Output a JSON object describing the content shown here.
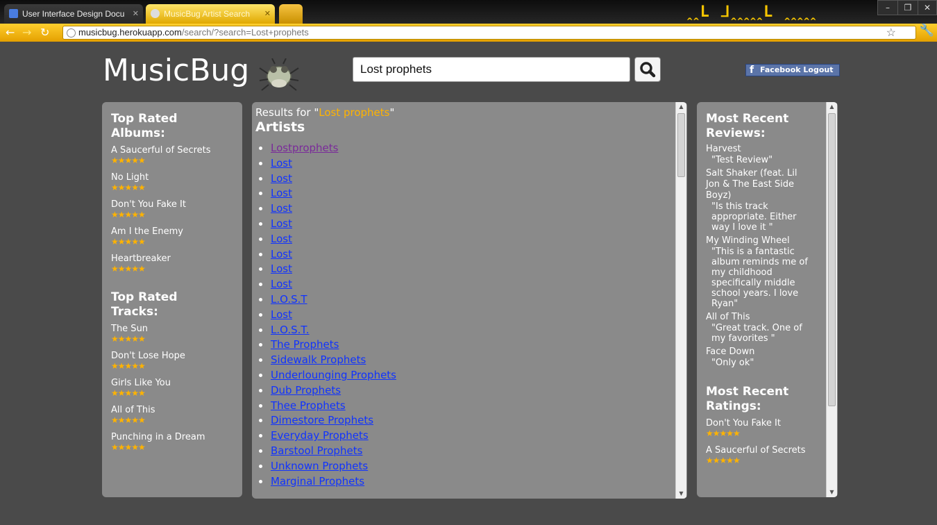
{
  "browser": {
    "tabs": [
      {
        "title": "User Interface Design Docu",
        "active": false
      },
      {
        "title": "MusicBug Artist Search",
        "active": true
      },
      {
        "title": "",
        "active": false
      }
    ],
    "url_host": "musicbug.herokuapp.com",
    "url_path": "/search/?search=Lost+prophets",
    "title_decoration": "ꞈꞈL ⅃ꞈꞈꞈꞈꞈL ꞈꞈꞈꞈꞈ"
  },
  "header": {
    "logo": "MusicBug",
    "search_value": "Lost prophets",
    "facebook_label": "Facebook Logout"
  },
  "left": {
    "albums_title_1": "Top Rated",
    "albums_title_2": "Albums:",
    "albums": [
      "A Saucerful of Secrets",
      "No Light",
      "Don't You Fake It",
      "Am I the Enemy",
      "Heartbreaker"
    ],
    "tracks_title_1": "Top Rated",
    "tracks_title_2": "Tracks:",
    "tracks": [
      "The Sun",
      "Don't Lose Hope",
      "Girls Like You",
      "All of This",
      "Punching in a Dream"
    ],
    "rating_stars": "★★★★★"
  },
  "main": {
    "results_prefix": "Results for \"",
    "query": "Lost prophets",
    "results_suffix": "\"",
    "artists_title": "Artists",
    "artists": [
      "Lostprophets",
      "Lost",
      "Lost",
      "Lost",
      "Lost",
      "Lost",
      "Lost",
      "Lost",
      "Lost",
      "Lost",
      "L.O.S.T",
      "Lost",
      "L.O.S.T.",
      "The Prophets",
      "Sidewalk Prophets",
      "Underlounging Prophets",
      "Dub Prophets",
      "Thee Prophets",
      "Dimestore Prophets",
      "Everyday Prophets",
      "Barstool Prophets",
      "Unknown Prophets",
      "Marginal Prophets"
    ]
  },
  "right": {
    "reviews_title_1": "Most Recent",
    "reviews_title_2": "Reviews:",
    "reviews": [
      {
        "title": "Harvest",
        "lines": [
          "\"Test Review\""
        ]
      },
      {
        "title": "Salt Shaker (feat. Lil Jon & The East Side Boyz)",
        "title_lines": [
          "Salt Shaker (feat. Lil",
          "Jon & The East Side",
          "Boyz)"
        ],
        "lines": [
          "\"Is this track",
          "appropriate. Either",
          "way I love it \""
        ]
      },
      {
        "title": "My Winding Wheel",
        "lines": [
          "\"This is a fantastic",
          "album reminds me of",
          "my childhood",
          "specifically middle",
          "school years. I love",
          "Ryan\""
        ]
      },
      {
        "title": "All of This",
        "lines": [
          "\"Great track. One of",
          "my favorites \""
        ]
      },
      {
        "title": "Face Down",
        "lines": [
          "\"Only ok\""
        ]
      }
    ],
    "ratings_title_1": "Most Recent",
    "ratings_title_2": "Ratings:",
    "ratings": [
      "Don't You Fake It",
      "A Saucerful of Secrets"
    ],
    "rating_stars": "★★★★★"
  },
  "colors": {
    "background": "#4a4a4a",
    "panel": "#8a8a8a",
    "accent": "#ffb300",
    "link": "#1033ff",
    "visited": "#7a2a9a"
  }
}
